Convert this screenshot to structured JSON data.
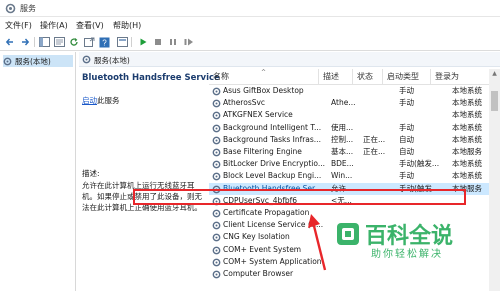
{
  "window": {
    "title": "服务"
  },
  "menu": {
    "items": [
      "文件(F)",
      "操作(A)",
      "查看(V)",
      "帮助(H)"
    ]
  },
  "tree": {
    "selected": "服务(本地)"
  },
  "header": {
    "left_label": "服务(本地)"
  },
  "detail": {
    "service_title": "Bluetooth Handsfree Service",
    "start_link": "启动",
    "start_suffix": "此服务",
    "desc_label": "描述:",
    "description": "允许在此计算机上运行无线蓝牙耳机。如果停止或禁用了此设备，则无法在此计算机上正确使用蓝牙耳机。"
  },
  "table": {
    "columns": {
      "name": "名称",
      "desc": "描述",
      "status": "状态",
      "start": "启动类型",
      "logon": "登录为"
    },
    "rows": [
      {
        "name": "Asus GiftBox Desktop",
        "desc": "",
        "status": "",
        "start": "手动",
        "logon": "本地系统"
      },
      {
        "name": "AtherosSvc",
        "desc": "Athe...",
        "status": "",
        "start": "手动",
        "logon": "本地系统"
      },
      {
        "name": "ATKGFNEX Service",
        "desc": "",
        "status": "",
        "start": "",
        "logon": "本地系统"
      },
      {
        "name": "Background Intelligent T...",
        "desc": "使用...",
        "status": "",
        "start": "手动",
        "logon": "本地系统"
      },
      {
        "name": "Background Tasks Infras...",
        "desc": "控制...",
        "status": "正在...",
        "start": "自动",
        "logon": "本地系统"
      },
      {
        "name": "Base Filtering Engine",
        "desc": "基本...",
        "status": "正在...",
        "start": "自动",
        "logon": "本地服务"
      },
      {
        "name": "BitLocker Drive Encryptio...",
        "desc": "BDE...",
        "status": "",
        "start": "手动(触发...",
        "logon": "本地系统"
      },
      {
        "name": "Block Level Backup Engi...",
        "desc": "Win...",
        "status": "",
        "start": "手动",
        "logon": "本地系统"
      },
      {
        "name": "Bluetooth Handsfree Ser...",
        "desc": "允许...",
        "status": "",
        "start": "手动(触发...",
        "logon": "本地服务"
      },
      {
        "name": "CDPUserSvc_4bfbf6",
        "desc": "<无...",
        "status": "",
        "start": "",
        "logon": ""
      },
      {
        "name": "Certificate Propagation",
        "desc": "",
        "status": "",
        "start": "",
        "logon": ""
      },
      {
        "name": "Client License Service (C...",
        "desc": "",
        "status": "",
        "start": "",
        "logon": ""
      },
      {
        "name": "CNG Key Isolation",
        "desc": "",
        "status": "",
        "start": "",
        "logon": ""
      },
      {
        "name": "COM+ Event System",
        "desc": "",
        "status": "",
        "start": "",
        "logon": ""
      },
      {
        "name": "COM+ System Application",
        "desc": "",
        "status": "",
        "start": "",
        "logon": ""
      },
      {
        "name": "Computer Browser",
        "desc": "",
        "status": "",
        "start": "",
        "logon": ""
      }
    ],
    "selected_index": 8
  },
  "watermark": {
    "main": "百科全说",
    "sub": "助你轻松解决"
  },
  "colors": {
    "highlight": "#e8262a",
    "watermark": "#3bb36a",
    "selection": "#cce8ff"
  }
}
